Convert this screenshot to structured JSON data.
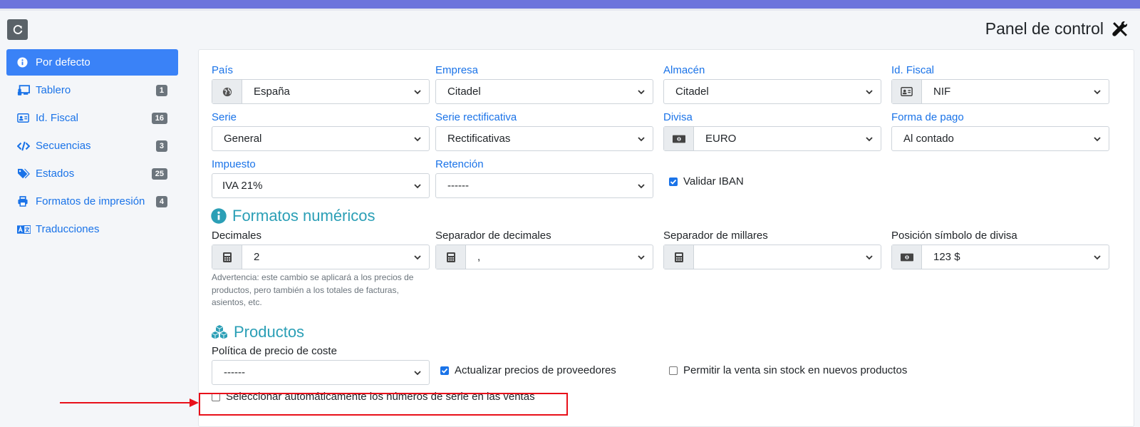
{
  "header": {
    "title": "Panel de control",
    "title_icon": "tools-icon",
    "refresh_icon": "refresh-icon"
  },
  "sidebar": {
    "items": [
      {
        "label": "Por defecto",
        "icon": "info-icon",
        "badge": ""
      },
      {
        "label": "Tablero",
        "icon": "chalkboard-icon",
        "badge": "1"
      },
      {
        "label": "Id. Fiscal",
        "icon": "id-card-icon",
        "badge": "16"
      },
      {
        "label": "Secuencias",
        "icon": "code-icon",
        "badge": "3"
      },
      {
        "label": "Estados",
        "icon": "tags-icon",
        "badge": "25"
      },
      {
        "label": "Formatos de impresión",
        "icon": "print-icon",
        "badge": "4"
      },
      {
        "label": "Traducciones",
        "icon": "language-icon",
        "badge": ""
      }
    ]
  },
  "form": {
    "pais": {
      "label": "País",
      "value": "España",
      "icon": "globe-icon"
    },
    "empresa": {
      "label": "Empresa",
      "value": "Citadel"
    },
    "almacen": {
      "label": "Almacén",
      "value": "Citadel"
    },
    "idfiscal": {
      "label": "Id. Fiscal",
      "value": "NIF",
      "icon": "id-card-icon"
    },
    "serie": {
      "label": "Serie",
      "value": "General"
    },
    "serie_rect": {
      "label": "Serie rectificativa",
      "value": "Rectificativas"
    },
    "divisa": {
      "label": "Divisa",
      "value": "EURO",
      "icon": "money-bill-icon"
    },
    "forma_pago": {
      "label": "Forma de pago",
      "value": "Al contado"
    },
    "impuesto": {
      "label": "Impuesto",
      "value": "IVA 21%"
    },
    "retencion": {
      "label": "Retención",
      "value": "------"
    },
    "validar_iban": {
      "label": "Validar IBAN",
      "checked": true
    }
  },
  "numeric": {
    "title": "Formatos numéricos",
    "decimales": {
      "label": "Decimales",
      "value": "2",
      "icon": "calculator-icon"
    },
    "sep_decimales": {
      "label": "Separador de decimales",
      "value": ",",
      "icon": "calculator-icon"
    },
    "sep_millares": {
      "label": "Separador de millares",
      "value": "",
      "icon": "calculator-icon"
    },
    "pos_simbolo": {
      "label": "Posición símbolo de divisa",
      "value": "123 $",
      "icon": "money-bill-icon"
    },
    "warning": "Advertencia: este cambio se aplicará a los precios de productos, pero también a los totales de facturas, asientos, etc."
  },
  "productos": {
    "title": "Productos",
    "politica": {
      "label": "Política de precio de coste",
      "value": "------"
    },
    "actualizar": {
      "label": "Actualizar precios de proveedores",
      "checked": true
    },
    "permitir": {
      "label": "Permitir la venta sin stock en nuevos productos",
      "checked": false
    },
    "seleccionar": {
      "label": "Seleccionar automáticamente los números de serie en las ventas",
      "checked": false
    }
  },
  "colors": {
    "accent": "#1a73e8",
    "section": "#2b9fb6",
    "topbar": "#6c74dc",
    "highlight": "#e8101a"
  }
}
